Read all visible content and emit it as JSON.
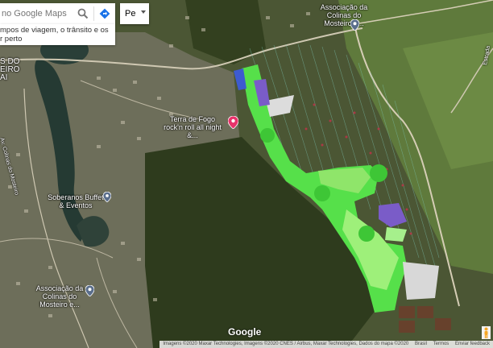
{
  "search": {
    "placeholder": "no Google Maps"
  },
  "promo_text": "mpos de viagem, o trânsito e os\nr perto",
  "language": {
    "value": "Pe"
  },
  "labels": {
    "assoc_top": "Associação da\nColinas do Mosteiro e...",
    "assoc_bottom": "Associação da\nColinas do Mosteiro e...",
    "terra_fogo": "Terra de Fogo\nrock'n roll all night &...",
    "soberanos": "Soberanos Buffet\n& Eventos",
    "left_text": "S DO\nEIRO\nAI",
    "road_left": "Av. Colinas do Mosteiro",
    "road_right": "Estrada"
  },
  "attribution": {
    "imagery": "Imagens ©2020 Maxar Technologies, Imagens ©2020 CNES / Airbus, Maxar Technologies, Dados do mapa ©2020",
    "country": "Brasil",
    "terms": "Termos",
    "feedback": "Enviar feedback"
  },
  "logo": "Google",
  "colors": {
    "overlay_green": "#56e04a",
    "overlay_light": "#9ef07a",
    "overlay_purple": "#7a5cc8",
    "pin_blue": "#5a6e8c",
    "pin_pink": "#e8336b"
  },
  "icons": {
    "search": "search-icon",
    "directions": "directions-icon",
    "place_pin": "place-pin-icon",
    "pegman": "pegman-icon"
  }
}
